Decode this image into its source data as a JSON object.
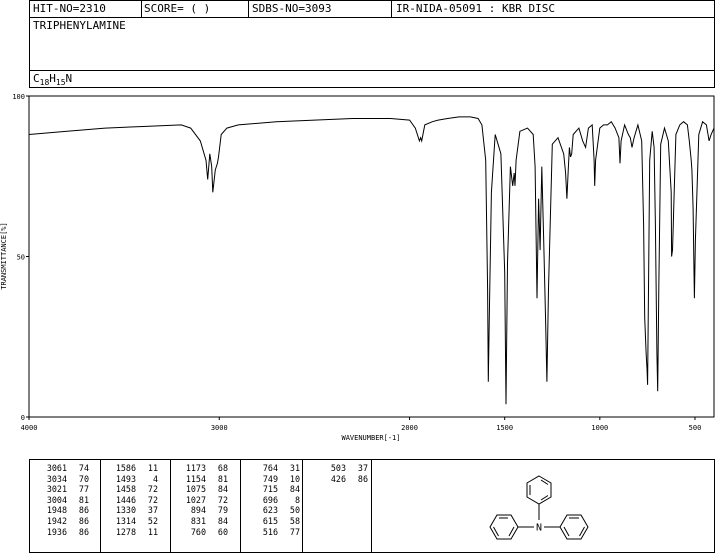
{
  "header": {
    "hit_no": "HIT-NO=2310",
    "score": "SCORE=  (   )",
    "sdbs_no": "SDBS-NO=3093",
    "method": "IR-NIDA-05091 : KBR DISC",
    "compound": "TRIPHENYLAMINE"
  },
  "formula": {
    "c": "C",
    "c_sub": "18",
    "h": "H",
    "h_sub": "15",
    "n": "N"
  },
  "chart_data": {
    "type": "line",
    "xlabel": "WAVENUMBER[-1]",
    "ylabel": "TRANSMITTANCE[%]",
    "xlim": [
      4000,
      400
    ],
    "ylim": [
      0,
      100
    ],
    "x_ticks": [
      4000,
      3000,
      2000,
      1500,
      1000,
      500
    ],
    "y_ticks": [
      0,
      50,
      100
    ],
    "grid": false,
    "series": [
      {
        "x": [
          4000,
          3800,
          3600,
          3400,
          3200,
          3150,
          3100,
          3070,
          3061,
          3050,
          3040,
          3034,
          3021,
          3010,
          3004,
          2990,
          2960,
          2900,
          2700,
          2500,
          2300,
          2100,
          2000,
          1970,
          1948,
          1942,
          1936,
          1920,
          1880,
          1850,
          1800,
          1740,
          1700,
          1680,
          1640,
          1620,
          1600,
          1590,
          1586,
          1580,
          1570,
          1550,
          1520,
          1500,
          1493,
          1485,
          1470,
          1458,
          1450,
          1446,
          1440,
          1420,
          1380,
          1350,
          1340,
          1330,
          1322,
          1314,
          1305,
          1295,
          1285,
          1278,
          1270,
          1250,
          1220,
          1190,
          1180,
          1173,
          1165,
          1160,
          1154,
          1148,
          1140,
          1110,
          1090,
          1075,
          1060,
          1040,
          1030,
          1027,
          1022,
          1000,
          980,
          960,
          940,
          920,
          900,
          894,
          888,
          870,
          850,
          840,
          831,
          820,
          800,
          780,
          770,
          764,
          757,
          752,
          749,
          746,
          738,
          725,
          715,
          708,
          700,
          696,
          690,
          680,
          660,
          640,
          625,
          623,
          618,
          615,
          610,
          600,
          580,
          560,
          540,
          530,
          520,
          516,
          510,
          505,
          503,
          498,
          480,
          460,
          440,
          426,
          415,
          400
        ],
        "y": [
          88,
          89,
          90,
          90.5,
          91,
          90,
          86,
          80,
          74,
          82,
          78,
          70,
          77,
          79,
          81,
          88,
          90,
          91,
          92,
          92.5,
          93,
          93,
          92.5,
          90,
          86,
          87,
          86,
          91,
          92,
          92.5,
          93,
          93.5,
          93.5,
          93.5,
          93,
          91,
          80,
          40,
          11,
          35,
          70,
          88,
          82,
          45,
          4,
          48,
          78,
          72,
          76,
          72,
          80,
          89,
          90,
          88,
          78,
          37,
          68,
          52,
          78,
          55,
          30,
          11,
          40,
          85,
          87,
          82,
          76,
          68,
          78,
          84,
          81,
          82,
          88,
          90,
          86,
          84,
          90,
          91,
          80,
          72,
          80,
          90,
          91,
          91,
          92,
          90,
          87,
          79,
          86,
          91,
          88,
          87,
          84,
          87,
          91,
          86,
          60,
          31,
          20,
          15,
          10,
          30,
          80,
          89,
          84,
          60,
          20,
          8,
          40,
          85,
          90,
          86,
          70,
          50,
          52,
          58,
          68,
          88,
          91,
          92,
          91,
          86,
          80,
          77,
          65,
          45,
          37,
          55,
          88,
          92,
          91,
          86,
          88,
          90
        ]
      }
    ]
  },
  "peaks": {
    "col1": [
      [
        "3061",
        "74"
      ],
      [
        "3034",
        "70"
      ],
      [
        "3021",
        "77"
      ],
      [
        "3004",
        "81"
      ],
      [
        "1948",
        "86"
      ],
      [
        "1942",
        "86"
      ],
      [
        "1936",
        "86"
      ]
    ],
    "col2": [
      [
        "1586",
        "11"
      ],
      [
        "1493",
        "4"
      ],
      [
        "1458",
        "72"
      ],
      [
        "1446",
        "72"
      ],
      [
        "1330",
        "37"
      ],
      [
        "1314",
        "52"
      ],
      [
        "1278",
        "11"
      ]
    ],
    "col3": [
      [
        "1173",
        "68"
      ],
      [
        "1154",
        "81"
      ],
      [
        "1075",
        "84"
      ],
      [
        "1027",
        "72"
      ],
      [
        "894",
        "79"
      ],
      [
        "831",
        "84"
      ],
      [
        "760",
        "60"
      ]
    ],
    "col4": [
      [
        "764",
        "31"
      ],
      [
        "749",
        "10"
      ],
      [
        "715",
        "84"
      ],
      [
        "696",
        "8"
      ],
      [
        "623",
        "50"
      ],
      [
        "615",
        "58"
      ],
      [
        "516",
        "77"
      ]
    ],
    "col5": [
      [
        "503",
        "37"
      ],
      [
        "426",
        "86"
      ]
    ]
  },
  "structure": {
    "atom_label": "N"
  }
}
